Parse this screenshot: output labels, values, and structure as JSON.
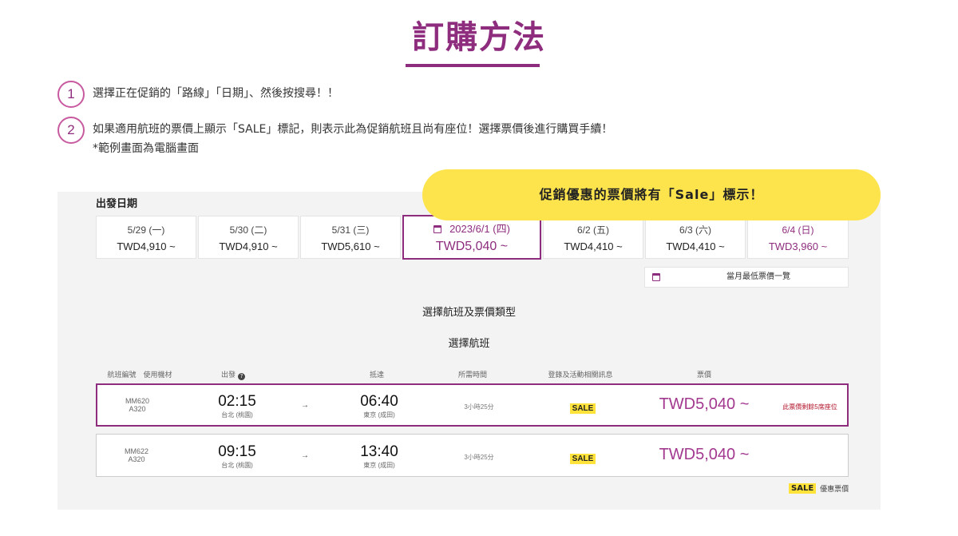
{
  "header": {
    "title": "訂購方法"
  },
  "steps": [
    {
      "num": "1",
      "text": "選擇正在促銷的「路線」「日期」、然後按搜尋！！",
      "note": ""
    },
    {
      "num": "2",
      "text": "如果適用航班的票價上顯示「SALE」標記，則表示此為促銷航班且尚有座位！選擇票價後進行購買手續！",
      "note": "*範例畫面為電腦畫面"
    }
  ],
  "callout": {
    "text": "促銷優惠的票價將有「Sale」標示！"
  },
  "booking": {
    "departure_label": "出發日期",
    "dates": [
      {
        "date": "5/29 (一)",
        "price": "TWD4,910 ~"
      },
      {
        "date": "5/30 (二)",
        "price": "TWD4,910 ~"
      },
      {
        "date": "5/31 (三)",
        "price": "TWD5,610 ~"
      },
      {
        "date": "2023/6/1 (四)",
        "price": "TWD5,040 ~"
      },
      {
        "date": "6/2 (五)",
        "price": "TWD4,410 ~"
      },
      {
        "date": "6/3 (六)",
        "price": "TWD4,410 ~"
      },
      {
        "date": "6/4 (日)",
        "price": "TWD3,960 ~"
      }
    ],
    "month_lowest_label": "當月最低票價一覽",
    "section_title": "選擇航班及票價類型",
    "sub_title": "選擇航班",
    "columns": {
      "flight": "航班編號　使用機材",
      "depart": "出發",
      "arrive": "抵達",
      "duration": "所需時間",
      "info": "登錄及活動相關訊息",
      "fare": "票價"
    },
    "flights": [
      {
        "flight_no": "MM620",
        "aircraft": "A320",
        "dep_time": "02:15",
        "dep_airport": "台北 (桃園)",
        "arrow": "→",
        "arr_time": "06:40",
        "arr_airport": "東京 (成田)",
        "duration": "3小時25分",
        "badge": "SALE",
        "fare": "TWD5,040 ~",
        "seats": "此票價剩餘5席座位"
      },
      {
        "flight_no": "MM622",
        "aircraft": "A320",
        "dep_time": "09:15",
        "dep_airport": "台北 (桃園)",
        "arrow": "→",
        "arr_time": "13:40",
        "arr_airport": "東京 (成田)",
        "duration": "3小時25分",
        "badge": "SALE",
        "fare": "TWD5,040 ~",
        "seats": ""
      }
    ],
    "legend": {
      "badge": "SALE",
      "text": "優惠票價"
    }
  },
  "colors": {
    "brand": "#8e2d7e",
    "sale_badge": "#ffe23a",
    "callout": "#fde44d",
    "seats_warning": "#b2142b"
  }
}
